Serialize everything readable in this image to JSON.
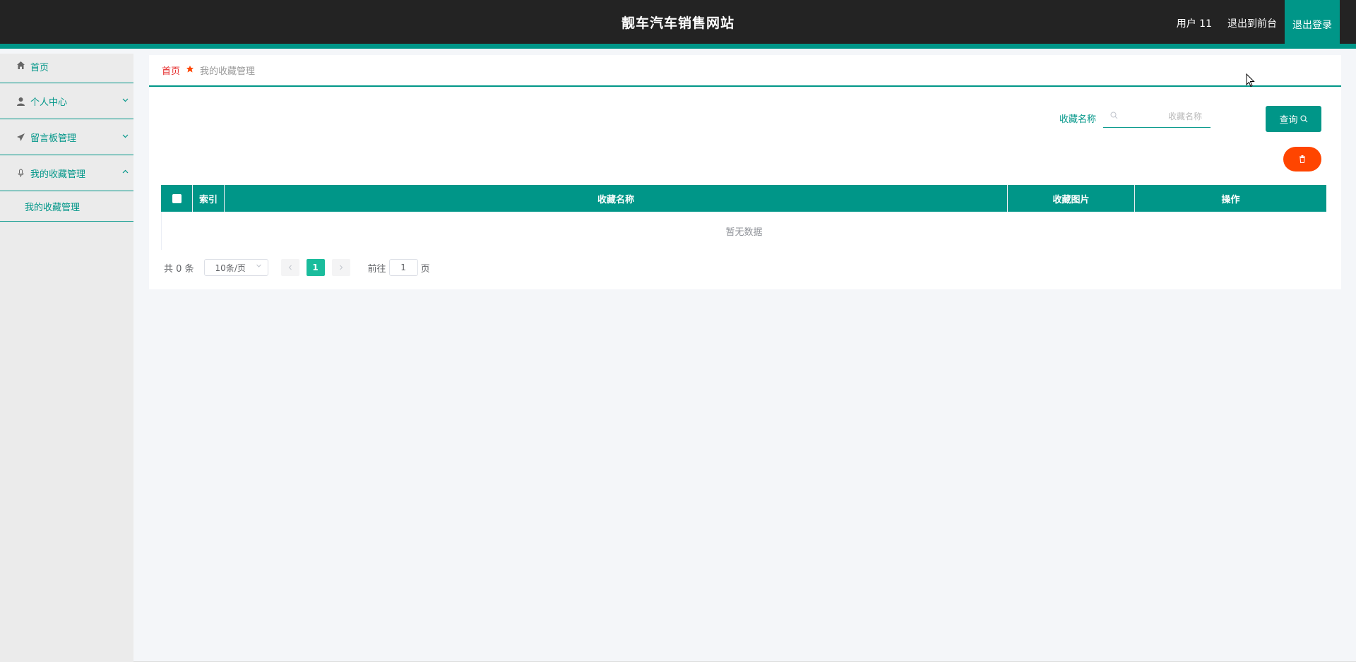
{
  "header": {
    "title": "靓车汽车销售网站",
    "user": "用户 11",
    "to_front": "退出到前台",
    "logout": "退出登录"
  },
  "sidebar": {
    "items": [
      {
        "label": "首页",
        "icon": "home-icon"
      },
      {
        "label": "个人中心",
        "icon": "user-icon"
      },
      {
        "label": "留言板管理",
        "icon": "paper-plane-icon"
      },
      {
        "label": "我的收藏管理",
        "icon": "microphone-icon"
      }
    ],
    "sub_items": [
      {
        "label": "我的收藏管理"
      }
    ]
  },
  "breadcrumb": {
    "home": "首页",
    "current": "我的收藏管理"
  },
  "search": {
    "label": "收藏名称",
    "placeholder": "收藏名称",
    "value": "",
    "button": "查询"
  },
  "table": {
    "columns": [
      "索引",
      "收藏名称",
      "收藏图片",
      "操作"
    ],
    "empty_text": "暂无数据",
    "rows": []
  },
  "pagination": {
    "total": "共 0 条",
    "page_size": "10条/页",
    "current_page": "1",
    "goto_label": "前往",
    "goto_value": "1",
    "page_suffix": "页"
  },
  "colors": {
    "primary": "#009688",
    "danger": "#ff4500",
    "header_bg": "#232323",
    "active_page": "#1abc9c"
  }
}
